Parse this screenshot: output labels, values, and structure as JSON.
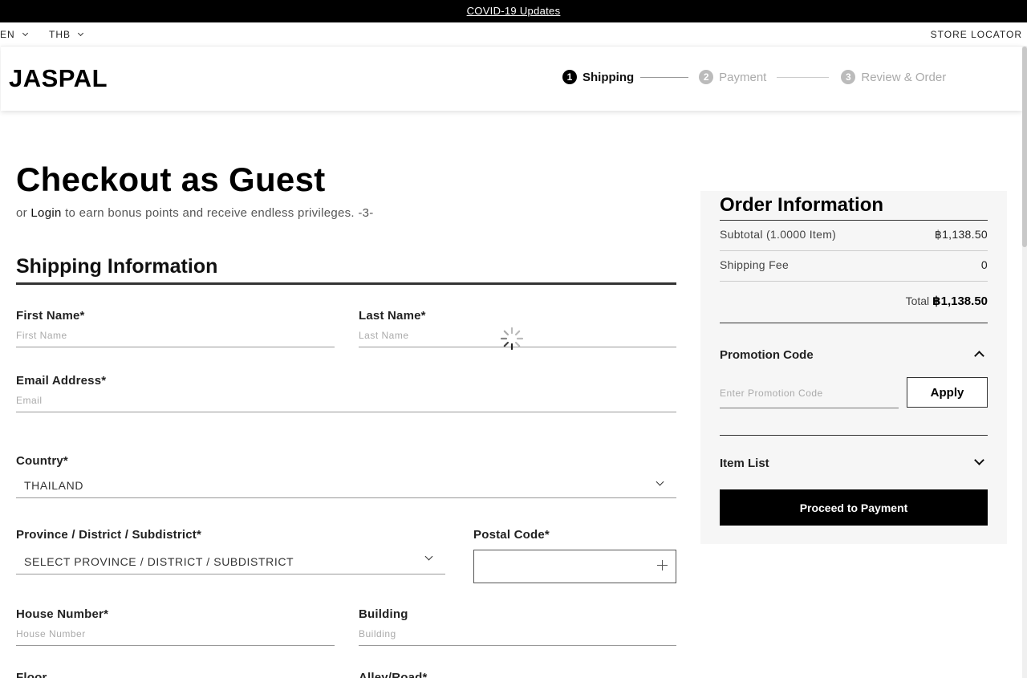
{
  "announcement": {
    "text": "COVID-19 Updates"
  },
  "utility": {
    "language": "EN",
    "currency": "THB",
    "store_locator": "STORE LOCATOR"
  },
  "header": {
    "logo": "JASPAL",
    "steps": [
      {
        "num": "1",
        "label": "Shipping"
      },
      {
        "num": "2",
        "label": "Payment"
      },
      {
        "num": "3",
        "label": "Review & Order"
      }
    ]
  },
  "checkout": {
    "title": "Checkout as Guest",
    "subtitle_pre": "or",
    "login": "Login",
    "subtitle_post": "to earn bonus points and receive endless privileges. -3-"
  },
  "shipping": {
    "title": "Shipping Information",
    "first_name": {
      "label": "First Name*",
      "placeholder": "First Name"
    },
    "last_name": {
      "label": "Last Name*",
      "placeholder": "Last Name"
    },
    "email": {
      "label": "Email Address*",
      "placeholder": "Email"
    },
    "country": {
      "label": "Country*",
      "value": "THAILAND"
    },
    "province": {
      "label": "Province / District / Subdistrict*",
      "value": "SELECT PROVINCE / DISTRICT / SUBDISTRICT"
    },
    "postal": {
      "label": "Postal Code*"
    },
    "house": {
      "label": "House Number*",
      "placeholder": "House Number"
    },
    "building": {
      "label": "Building",
      "placeholder": "Building"
    },
    "floor": {
      "label": "Floor"
    },
    "alley": {
      "label": "Alley/Road*"
    }
  },
  "order": {
    "title": "Order Information",
    "subtitle_label": "Subtotal (1.0000 Item)",
    "subtotal_value": "฿1,138.50",
    "shipping_label": "Shipping Fee",
    "shipping_value": "0",
    "total_label": "Total",
    "total_value": "฿1,138.50",
    "promo_label": "Promotion Code",
    "promo_placeholder": "Enter Promotion Code",
    "apply": "Apply",
    "item_list": "Item List",
    "proceed": "Proceed to Payment"
  }
}
